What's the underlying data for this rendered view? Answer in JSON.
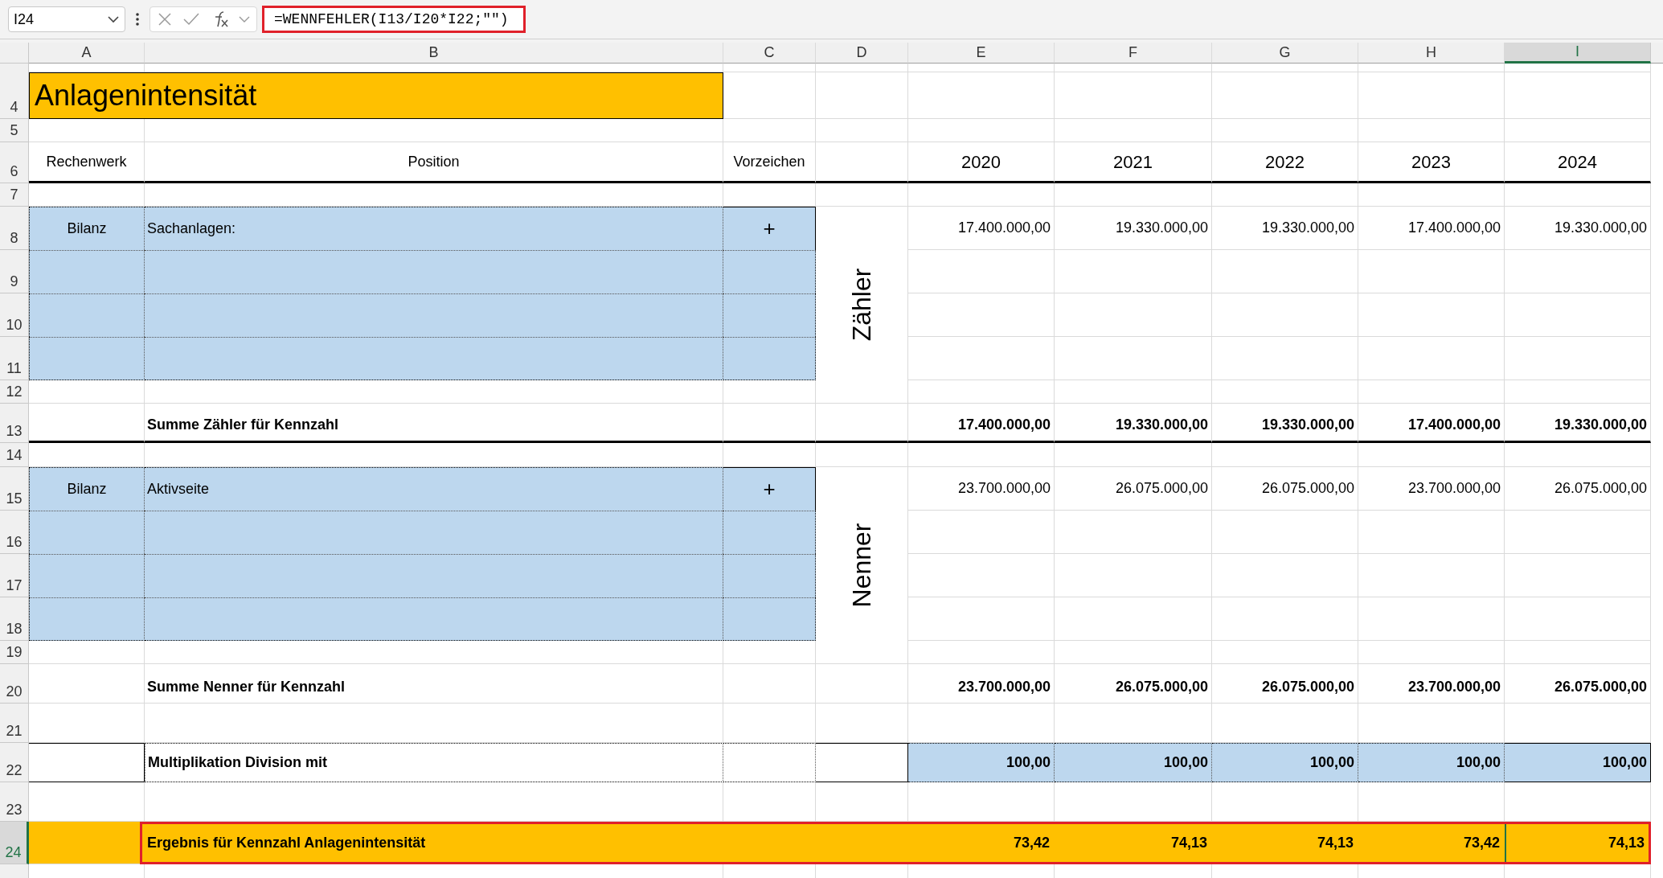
{
  "name_box": "I24",
  "formula_bar": {
    "formula": "=WENNFEHLER(I13/I20*I22;\"\")",
    "highlighted": true
  },
  "column_headers": [
    {
      "label": "A",
      "selected": false
    },
    {
      "label": "B",
      "selected": false
    },
    {
      "label": "C",
      "selected": false
    },
    {
      "label": "D",
      "selected": false
    },
    {
      "label": "E",
      "selected": false
    },
    {
      "label": "F",
      "selected": false
    },
    {
      "label": "G",
      "selected": false
    },
    {
      "label": "H",
      "selected": false
    },
    {
      "label": "I",
      "selected": true
    }
  ],
  "rows": [
    {
      "number": "4",
      "selected": false,
      "kind": "title",
      "text": "Anlagenintensität"
    },
    {
      "number": "5",
      "selected": false,
      "kind": "blank"
    },
    {
      "number": "6",
      "selected": false,
      "kind": "header",
      "rechenwerk": "Rechenwerk",
      "position": "Position",
      "sign": "Vorzeichen",
      "years": [
        "2020",
        "2021",
        "2022",
        "2023",
        "2024"
      ],
      "rule_below": true
    },
    {
      "number": "7",
      "selected": false,
      "kind": "blank"
    },
    {
      "number": "8",
      "selected": false,
      "kind": "input",
      "side_label": "Zähler",
      "rechenwerk": "Bilanz",
      "position": "Sachanlagen:",
      "sign": "+",
      "values": [
        "17.400.000,00",
        "19.330.000,00",
        "19.330.000,00",
        "17.400.000,00",
        "19.330.000,00"
      ]
    },
    {
      "number": "9",
      "selected": false,
      "kind": "input"
    },
    {
      "number": "10",
      "selected": false,
      "kind": "input"
    },
    {
      "number": "11",
      "selected": false,
      "kind": "input"
    },
    {
      "number": "12",
      "selected": false,
      "kind": "blank"
    },
    {
      "number": "13",
      "selected": false,
      "kind": "sum",
      "label": "Summe Zähler für Kennzahl",
      "values": [
        "17.400.000,00",
        "19.330.000,00",
        "19.330.000,00",
        "17.400.000,00",
        "19.330.000,00"
      ],
      "rule_below": true
    },
    {
      "number": "14",
      "selected": false,
      "kind": "blank"
    },
    {
      "number": "15",
      "selected": false,
      "kind": "input",
      "side_label": "Nenner",
      "rechenwerk": "Bilanz",
      "position": "Aktivseite",
      "sign": "+",
      "values": [
        "23.700.000,00",
        "26.075.000,00",
        "26.075.000,00",
        "23.700.000,00",
        "26.075.000,00"
      ]
    },
    {
      "number": "16",
      "selected": false,
      "kind": "input"
    },
    {
      "number": "17",
      "selected": false,
      "kind": "input"
    },
    {
      "number": "18",
      "selected": false,
      "kind": "input"
    },
    {
      "number": "19",
      "selected": false,
      "kind": "blank"
    },
    {
      "number": "20",
      "selected": false,
      "kind": "sum",
      "label": "Summe Nenner für Kennzahl",
      "values": [
        "23.700.000,00",
        "26.075.000,00",
        "26.075.000,00",
        "23.700.000,00",
        "26.075.000,00"
      ],
      "rule_below": false
    },
    {
      "number": "21",
      "selected": false,
      "kind": "blank"
    },
    {
      "number": "22",
      "selected": false,
      "kind": "factor",
      "label": "Multiplikation Division mit",
      "values": [
        "100,00",
        "100,00",
        "100,00",
        "100,00",
        "100,00"
      ]
    },
    {
      "number": "23",
      "selected": false,
      "kind": "blank"
    },
    {
      "number": "24",
      "selected": true,
      "kind": "result",
      "label": "Ergebnis für Kennzahl Anlagenintensität",
      "highlighted": true,
      "values": [
        {
          "text": "73,42",
          "selected": false
        },
        {
          "text": "74,13",
          "selected": false
        },
        {
          "text": "74,13",
          "selected": false
        },
        {
          "text": "73,42",
          "selected": false
        },
        {
          "text": "74,13",
          "selected": true
        }
      ]
    }
  ]
}
